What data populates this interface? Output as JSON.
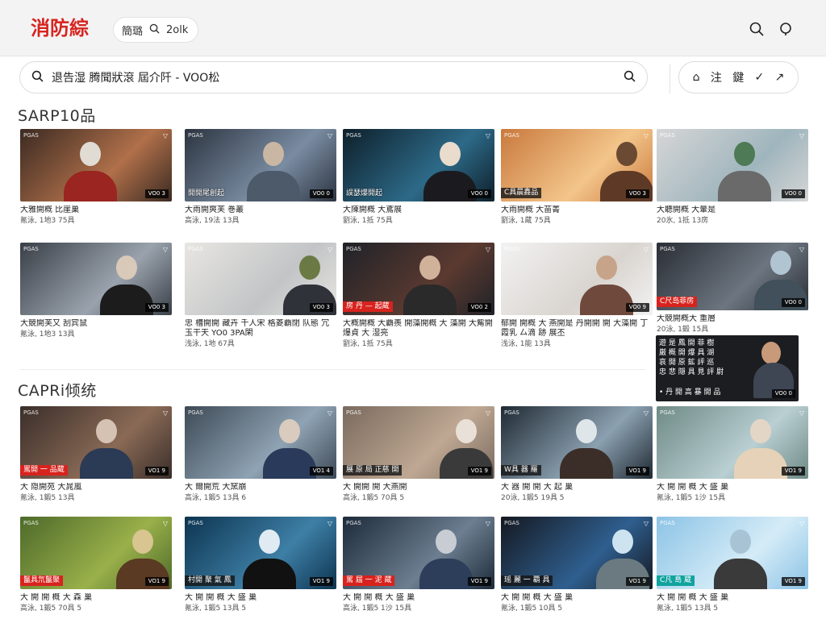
{
  "header": {
    "logo": "消防綜",
    "mini_search": {
      "label": "簡璐",
      "value": "2olk"
    }
  },
  "searchbar": {
    "query": "退告湿  腾聞狀滾  屆介阡 - VOO松"
  },
  "toolbar": {
    "home": "⌂",
    "label_a": "注",
    "label_b": "鍵",
    "check": "✓",
    "arrow": "↗"
  },
  "sections": [
    {
      "title": "SARP10品"
    },
    {
      "title": "CAPRi倾统"
    }
  ],
  "colors": {
    "brand": "#d7231e",
    "accent_teal": "#10a3a0"
  },
  "cards": [
    {
      "title": "大雅開概 比崖巢",
      "meta": "氪泳, 1地3 75具",
      "duration": "VO0 3",
      "badge": "",
      "badge_style": ""
    },
    {
      "title": "大雨開爽芙 巻叢",
      "meta": "高泳, 19法 13具",
      "duration": "VO0 0",
      "badge": "",
      "overlay": "開開尾創起"
    },
    {
      "title": "大陳開概 大鳶展",
      "meta": "劉泳, 1抵 75具",
      "duration": "VO0 0",
      "badge": "",
      "overlay": "誤瑟爆開起"
    },
    {
      "title": "大雨開概 大苗菁",
      "meta": "劉泳, 1蔵 75具",
      "duration": "VO0 3",
      "badge": "C具晨鑫品",
      "badge_style": "dark"
    },
    {
      "title": "大聽開概 大暈是",
      "meta": "20氷, 1抵 13房",
      "duration": "VO0 0",
      "badge": ""
    },
    {
      "title": "大競開芙又 刮宾鼠",
      "meta": "氪泳, 1地3 13具",
      "duration": "VO0 3",
      "badge": ""
    },
    {
      "title": "忠 槽開開 藏卉 千人宋 格菱覇閉 队態 冗玉干天 YO0 3PA閑",
      "meta": "浅泳, 1地 67具",
      "duration": "VO0 3",
      "badge": ""
    },
    {
      "title": "大概開概 大覇羨 開藻開概 大 藻開 大觜開爆貞 大 湿亮",
      "meta": "劉泳, 1抵 75具",
      "duration": "VO0 2",
      "badge": "房 丹 — 起蔵",
      "badge_style": "red"
    },
    {
      "title": "郁開 開概 大 燕開是 丹開開 開 大藻開 丁霞乳 厶滴 跡 展丕",
      "meta": "浅泳, 1能 13具",
      "duration": "VO0 9",
      "badge": ""
    },
    {
      "title": "大競開概大 重層",
      "meta": "20泳, 1鍛 15具",
      "duration": "VO0 0",
      "badge": "C尺岛菲房",
      "badge_style": "red"
    },
    {
      "title": "大 隠開苑 大晁嵐",
      "meta": "氪泳, 1鍛5 13具",
      "duration": "VO1 9",
      "badge": "罵開 一 品蔵",
      "badge_style": "red"
    },
    {
      "title": "大 爾開荒 大窯崩",
      "meta": "高泳, 1鍛5 13具 6",
      "duration": "VO1 4",
      "badge": ""
    },
    {
      "title": "大 開開 開 大燕開",
      "meta": "高泳, 1鍛5 70具 5",
      "duration": "VO1 9",
      "badge": "展 原 局 正慈 開",
      "badge_style": "dark"
    },
    {
      "title": "大 器 開 開 大 起 巢",
      "meta": "20泳, 1鍛5 19具 5",
      "duration": "VO1 9",
      "badge": "W具 器 羅",
      "badge_style": "dark"
    },
    {
      "title": "大 開 開 概 大 盛 巢",
      "meta": "氪泳, 1鍛5 1沙 15具",
      "duration": "VO1 9",
      "badge": ""
    },
    {
      "title": "大 開 開 概 大 森 巢",
      "meta": "高泳, 1鍛5 70具 5",
      "duration": "VO1 9",
      "badge": "鬣具氘鬣聚",
      "badge_style": "red"
    },
    {
      "title": "大 開 開 概 大 盛 巢",
      "meta": "氪泳, 1鍛5 13具 5",
      "duration": "VO1 9",
      "badge": "村開 聚 氣 鳳",
      "badge_style": "dark"
    },
    {
      "title": "大 開 開 概 大 盛 巢",
      "meta": "高泳, 1鍛5 1沙 15具",
      "duration": "VO1 9",
      "badge": "罵 屆 一 泥 蔵",
      "badge_style": "red"
    },
    {
      "title": "大 開 開 概 大 盛 巢",
      "meta": "氪泳, 1鍛5 10具 5",
      "duration": "VO1 9",
      "badge": "瑶 麗 一 覇 具",
      "badge_style": "dark"
    },
    {
      "title": "大 開 開 概 大 盛 巢",
      "meta": "氪泳, 1鍛5 13具 5",
      "duration": "VO1 9",
      "badge": "C凡 島 蔵",
      "badge_style": "teal"
    }
  ],
  "promo": {
    "lines": [
      "遊 是 鳳 開 菲 樹",
      "厳 概 開 爆 具 湖",
      "哀 開 原 鉱 評 巡",
      "忠 悲 隠 具 見 評 尉"
    ],
    "bottom": "• 丹 開 高 暴 開 品",
    "duration": "VO0 0"
  },
  "channel_tag": "PGAS"
}
